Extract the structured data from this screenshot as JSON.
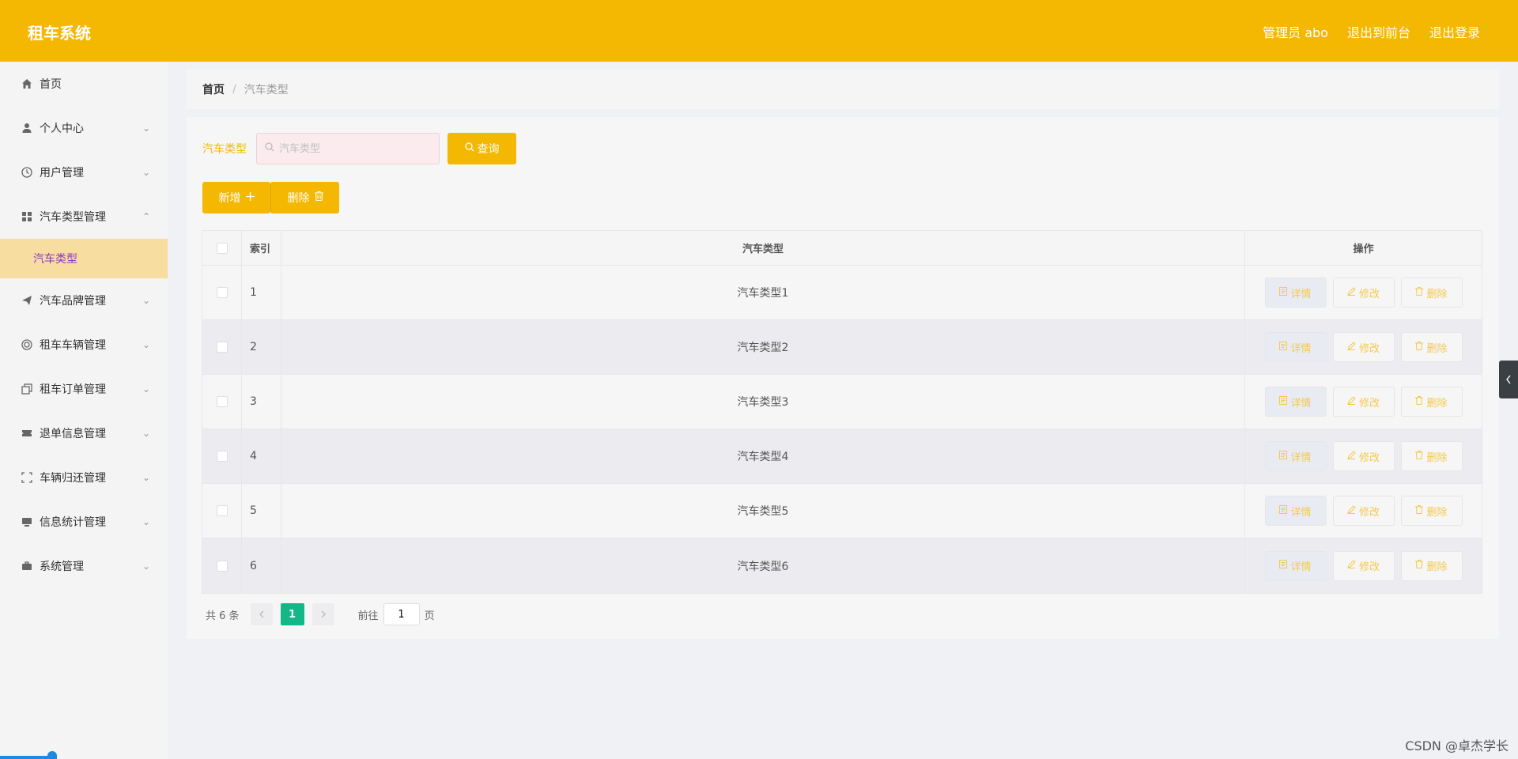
{
  "app": {
    "title": "租车系统"
  },
  "header": {
    "user": "管理员 abo",
    "to_front": "退出到前台",
    "logout": "退出登录"
  },
  "sidebar": {
    "items": [
      {
        "label": "首页",
        "icon": "home-icon",
        "has_children": false
      },
      {
        "label": "个人中心",
        "icon": "user-icon",
        "has_children": true
      },
      {
        "label": "用户管理",
        "icon": "clock-icon",
        "has_children": true
      },
      {
        "label": "汽车类型管理",
        "icon": "grid-icon",
        "has_children": true,
        "expanded": true
      },
      {
        "label": "汽车品牌管理",
        "icon": "send-icon",
        "has_children": true
      },
      {
        "label": "租车车辆管理",
        "icon": "circle-icon",
        "has_children": true
      },
      {
        "label": "租车订单管理",
        "icon": "copy-icon",
        "has_children": true
      },
      {
        "label": "退单信息管理",
        "icon": "ticket-icon",
        "has_children": true
      },
      {
        "label": "车辆归还管理",
        "icon": "fullscreen-icon",
        "has_children": true
      },
      {
        "label": "信息统计管理",
        "icon": "monitor-icon",
        "has_children": true
      },
      {
        "label": "系统管理",
        "icon": "briefcase-icon",
        "has_children": true
      }
    ],
    "active_sub": "汽车类型"
  },
  "breadcrumb": {
    "home": "首页",
    "sep": "/",
    "current": "汽车类型"
  },
  "search": {
    "label": "汽车类型",
    "placeholder": "汽车类型",
    "value": "",
    "button": "查询"
  },
  "actions": {
    "add": "新增",
    "delete": "删除"
  },
  "table": {
    "headers": {
      "index": "索引",
      "type": "汽车类型",
      "ops": "操作"
    },
    "rows": [
      {
        "index": "1",
        "type": "汽车类型1"
      },
      {
        "index": "2",
        "type": "汽车类型2"
      },
      {
        "index": "3",
        "type": "汽车类型3"
      },
      {
        "index": "4",
        "type": "汽车类型4"
      },
      {
        "index": "5",
        "type": "汽车类型5"
      },
      {
        "index": "6",
        "type": "汽车类型6"
      }
    ],
    "row_actions": {
      "detail": "详情",
      "edit": "修改",
      "delete": "删除"
    }
  },
  "pagination": {
    "total": "共 6 条",
    "current": "1",
    "goto": "前往",
    "page_value": "1",
    "unit": "页"
  },
  "watermark": "CSDN @卓杰学长",
  "colors": {
    "accent": "#f4b802",
    "active_sub_bg": "#f7dd9f",
    "active_sub_text": "#8c3ab8",
    "page_current": "#13b886"
  }
}
